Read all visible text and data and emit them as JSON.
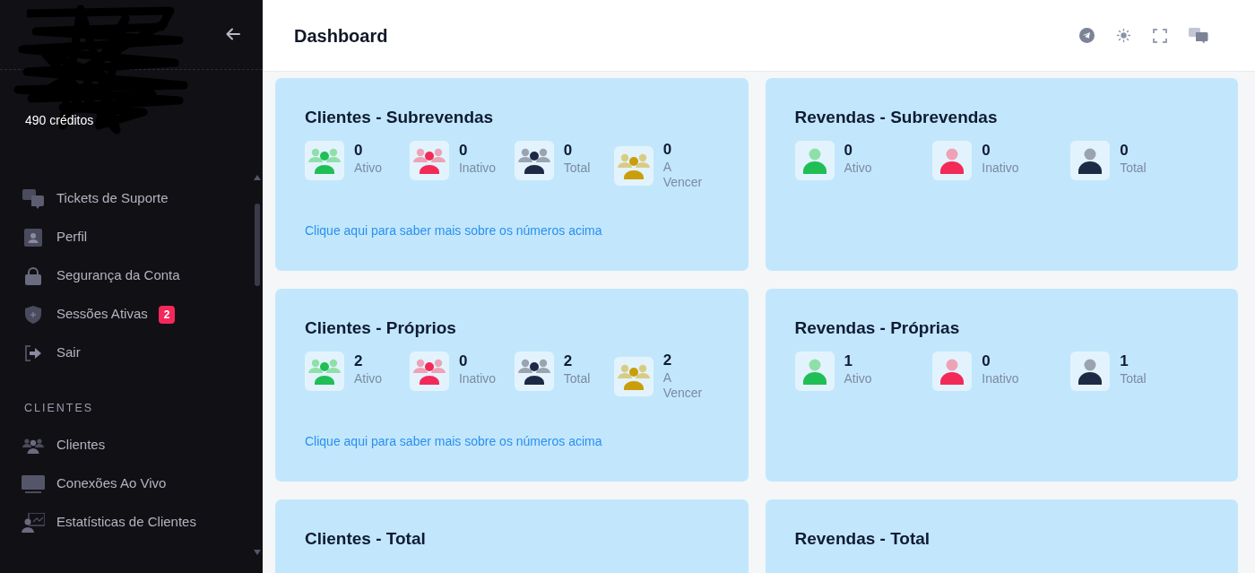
{
  "sidebar": {
    "credits": "490 créditos",
    "items": [
      {
        "label": "Tickets de Suporte",
        "kind": "tickets"
      },
      {
        "label": "Perfil",
        "kind": "profile"
      },
      {
        "label": "Segurança da Conta",
        "kind": "lock"
      },
      {
        "label": "Sessões Ativas",
        "kind": "shield",
        "badge": "2"
      },
      {
        "label": "Sair",
        "kind": "logout"
      }
    ],
    "sections": [
      {
        "title": "CLIENTES",
        "items": [
          {
            "label": "Clientes",
            "kind": "users"
          },
          {
            "label": "Conexões Ao Vivo",
            "kind": "monitor"
          },
          {
            "label": "Estatísticas de Clientes",
            "kind": "stats"
          }
        ]
      }
    ]
  },
  "header": {
    "title": "Dashboard"
  },
  "cards": [
    {
      "title": "Clientes - Subrevendas",
      "kind": "clients",
      "stats": [
        {
          "value": "0",
          "label": "Ativo",
          "kind": "active"
        },
        {
          "value": "0",
          "label": "Inativo",
          "kind": "inactive"
        },
        {
          "value": "0",
          "label": "Total",
          "kind": "total"
        },
        {
          "value": "0",
          "label": "A Vencer",
          "kind": "expiring"
        }
      ],
      "link": "Clique aqui para saber mais sobre os números acima"
    },
    {
      "title": "Revendas - Subrevendas",
      "kind": "resellers",
      "stats": [
        {
          "value": "0",
          "label": "Ativo",
          "kind": "active"
        },
        {
          "value": "0",
          "label": "Inativo",
          "kind": "inactive"
        },
        {
          "value": "0",
          "label": "Total",
          "kind": "total"
        }
      ]
    },
    {
      "title": "Clientes - Próprios",
      "kind": "clients",
      "stats": [
        {
          "value": "2",
          "label": "Ativo",
          "kind": "active"
        },
        {
          "value": "0",
          "label": "Inativo",
          "kind": "inactive"
        },
        {
          "value": "2",
          "label": "Total",
          "kind": "total"
        },
        {
          "value": "2",
          "label": "A Vencer",
          "kind": "expiring"
        }
      ],
      "link": "Clique aqui para saber mais sobre os números acima"
    },
    {
      "title": "Revendas - Próprias",
      "kind": "resellers",
      "stats": [
        {
          "value": "1",
          "label": "Ativo",
          "kind": "active"
        },
        {
          "value": "0",
          "label": "Inativo",
          "kind": "inactive"
        },
        {
          "value": "1",
          "label": "Total",
          "kind": "total"
        }
      ]
    },
    {
      "title": "Clientes - Total",
      "kind": "clients"
    },
    {
      "title": "Revendas - Total",
      "kind": "resellers"
    }
  ]
}
